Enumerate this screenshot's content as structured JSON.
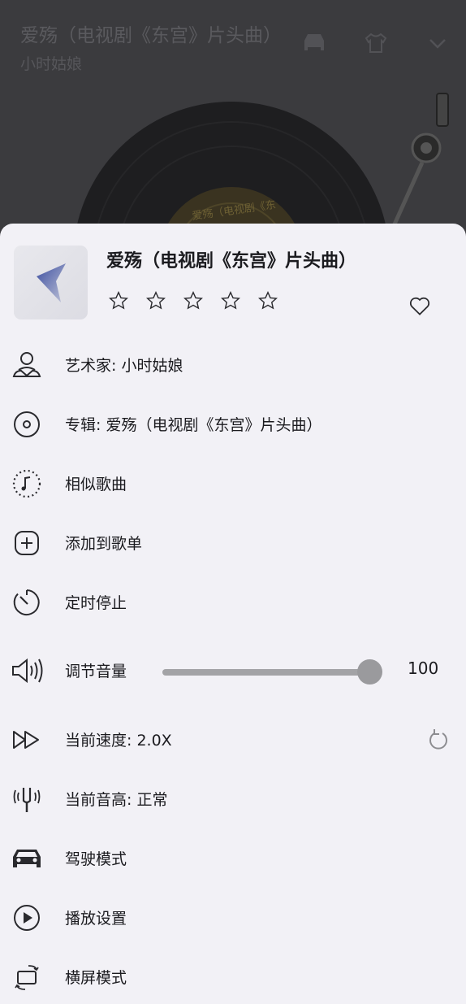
{
  "background": {
    "title": "爱殇（电视剧《东宫》片头曲）",
    "artist": "小时姑娘",
    "icons": [
      "car-icon",
      "shirt-icon",
      "chevron-down-icon"
    ],
    "vinyl_label": "爱殇（电视剧《东"
  },
  "song": {
    "title": "爱殇（电视剧《东宫》片头曲）",
    "rating": 0,
    "rating_max": 5,
    "favorited": false
  },
  "menu": {
    "artist": "艺术家: 小时姑娘",
    "album": "专辑: 爱殇（电视剧《东宫》片头曲）",
    "similar": "相似歌曲",
    "add_playlist": "添加到歌单",
    "timer": "定时停止",
    "volume_label": "调节音量",
    "volume_value": "100",
    "speed": "当前速度: 2.0X",
    "pitch": "当前音高: 正常",
    "drive": "驾驶模式",
    "play_settings": "播放设置",
    "landscape": "横屏模式"
  },
  "colors": {
    "sheet": "#f2f1f6",
    "text": "#1b1b1f",
    "icon": "#2a2a2e",
    "backdrop": "#3b3b3e"
  }
}
